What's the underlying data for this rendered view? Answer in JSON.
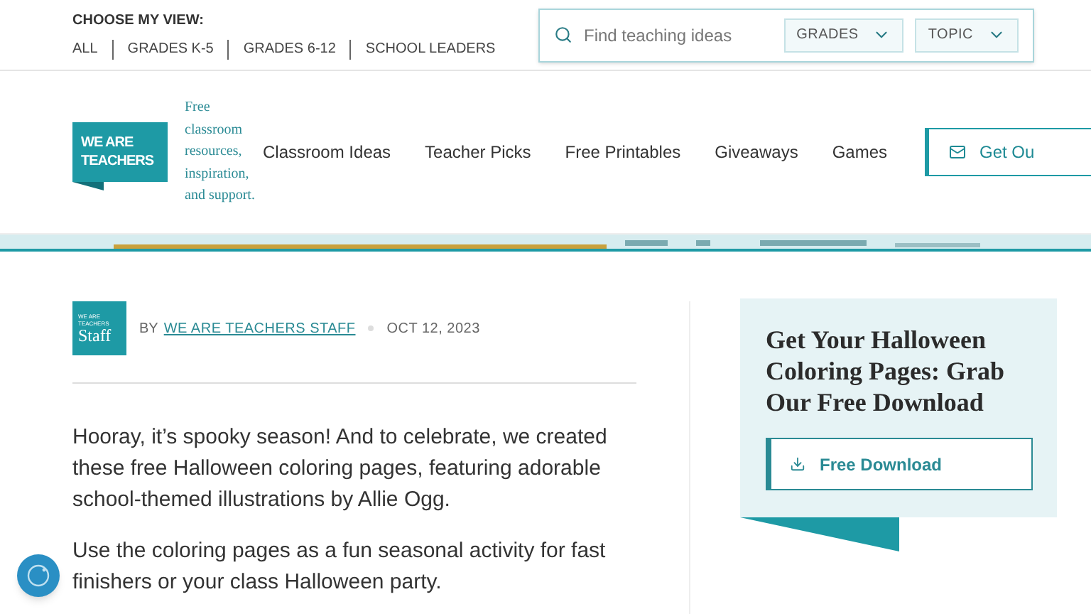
{
  "view_selector": {
    "label": "CHOOSE MY VIEW:",
    "options": [
      {
        "label": "ALL",
        "selected": false
      },
      {
        "label": "GRADES K-5",
        "selected": false
      },
      {
        "label": "GRADES 6-12",
        "selected": false
      },
      {
        "label": "SCHOOL LEADERS",
        "selected": false
      }
    ]
  },
  "search": {
    "placeholder": "Find teaching ideas",
    "filters": [
      "GRADES",
      "TOPIC"
    ]
  },
  "logo": {
    "line_1": "WE ARE",
    "line_2": "TEACHERS",
    "tagline": "Free classroom resources, inspiration, and support."
  },
  "nav": {
    "items": [
      "Classroom Ideas",
      "Teacher Picks",
      "Free Printables",
      "Giveaways",
      "Games"
    ],
    "cta": "Get Ou"
  },
  "byline": {
    "avatar_small": "WE ARE TEACHERS",
    "avatar_big": "Staff",
    "prefix": "BY",
    "author": "WE ARE TEACHERS STAFF",
    "date": "OCT 12, 2023"
  },
  "paragraphs": [
    "Hooray, it’s spooky season! And to celebrate, we created these free Halloween coloring pages, featuring adorable school-themed illustrations by Allie Ogg.",
    "Use the coloring pages as a fun seasonal activity for fast finishers or your class Halloween party."
  ],
  "promo": {
    "title": "Get Your Halloween Coloring Pages: Grab Our Free Download",
    "button": "Free Download"
  }
}
